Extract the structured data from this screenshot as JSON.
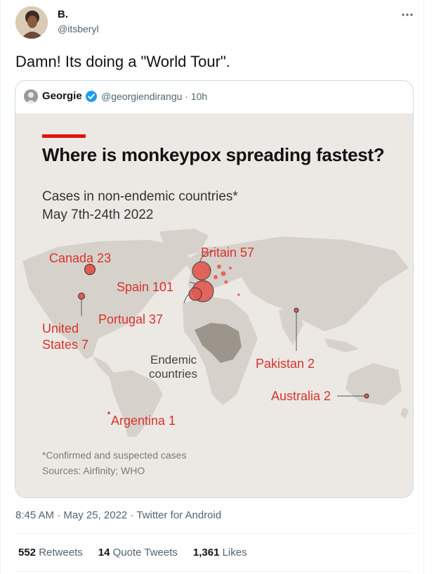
{
  "tweet": {
    "display_name": "B.",
    "handle": "@itsberyl",
    "text": "Damn! Its doing a \"World Tour\".",
    "timestamp": "8:45 AM · May 25, 2022 · Twitter for Android",
    "stats": {
      "retweets_count": "552",
      "retweets_label": "Retweets",
      "quotes_count": "14",
      "quotes_label": "Quote Tweets",
      "likes_count": "1,361",
      "likes_label": "Likes"
    }
  },
  "quoted": {
    "name": "Georgie",
    "handle_time": "@georgiendirangu · 10h"
  },
  "infographic": {
    "title": "Where is monkeypox spreading fastest?",
    "subtitle": "Cases in non-endemic countries*",
    "dates": "May 7th-24th 2022",
    "footnote": "*Confirmed and suspected cases",
    "sources": "Sources: Airfinity; WHO",
    "labels": {
      "canada": "Canada 23",
      "britain": "Britain 57",
      "spain": "Spain 101",
      "portugal": "Portugal 37",
      "us_line1": "United",
      "us_line2": "States 7",
      "endemic_line1": "Endemic",
      "endemic_line2": "countries",
      "pakistan": "Pakistan 2",
      "australia": "Australia 2",
      "argentina": "Argentina 1"
    },
    "colors": {
      "accent": "#e3120b",
      "label": "#d7332c",
      "bubble": "#e05a50",
      "land": "#d6d2cb",
      "endemic": "#9c958b"
    }
  }
}
